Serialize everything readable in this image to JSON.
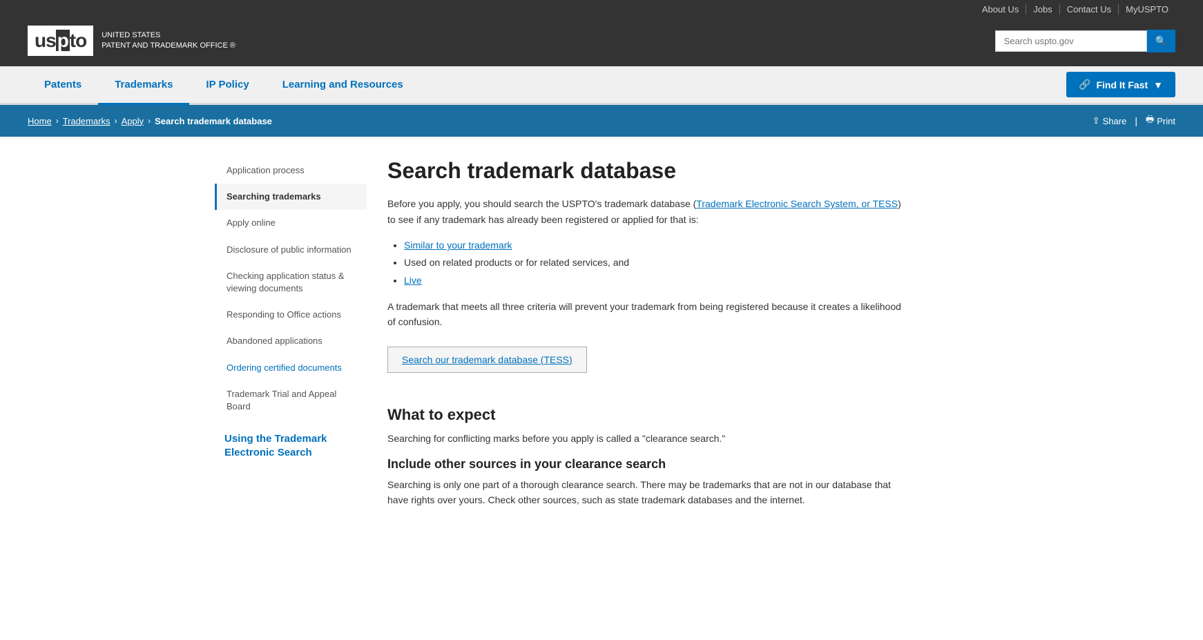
{
  "topbar": {
    "links": [
      "About Us",
      "Jobs",
      "Contact Us",
      "MyUSPTO"
    ]
  },
  "header": {
    "logo_main": "uspto",
    "logo_highlight": "to",
    "logo_tagline_line1": "UNITED STATES",
    "logo_tagline_line2": "PATENT AND TRADEMARK OFFICE",
    "logo_tagline_symbol": "®",
    "search_placeholder": "Search uspto.gov"
  },
  "mainnav": {
    "items": [
      {
        "label": "Patents",
        "active": false
      },
      {
        "label": "Trademarks",
        "active": true
      },
      {
        "label": "IP Policy",
        "active": false
      },
      {
        "label": "Learning and Resources",
        "active": false
      }
    ],
    "find_it_fast": "Find It Fast"
  },
  "breadcrumb": {
    "items": [
      "Home",
      "Trademarks",
      "Apply"
    ],
    "current": "Search trademark database",
    "share_label": "Share",
    "print_label": "Print"
  },
  "sidebar": {
    "items": [
      {
        "label": "Application process",
        "active": false
      },
      {
        "label": "Searching trademarks",
        "active": true
      },
      {
        "label": "Apply online",
        "active": false
      },
      {
        "label": "Disclosure of public information",
        "active": false
      },
      {
        "label": "Checking application status & viewing documents",
        "active": false
      },
      {
        "label": "Responding to Office actions",
        "active": false
      },
      {
        "label": "Abandoned applications",
        "active": false
      },
      {
        "label": "Ordering certified documents",
        "active": false
      },
      {
        "label": "Trademark Trial and Appeal Board",
        "active": false
      }
    ],
    "section_title": "Using the Trademark Electronic Search"
  },
  "main": {
    "page_title": "Search trademark database",
    "intro_text": "Before you apply, you should search the USPTO's trademark database (",
    "tess_link_text": "Trademark Electronic Search System, or TESS",
    "intro_text2": ") to see if any trademark has already been registered or applied for that is:",
    "bullet_items": [
      {
        "text": "Similar to your trademark",
        "is_link": true
      },
      {
        "text": "Used on related products or for related services, and",
        "is_link": false
      },
      {
        "text": "Live",
        "is_link": true
      }
    ],
    "confusion_text": "A trademark that meets all three criteria will prevent your trademark from being registered because it creates a likelihood of confusion.",
    "tess_button_label": "Search our trademark database (TESS)",
    "what_to_expect_heading": "What to expect",
    "what_to_expect_text": "Searching for conflicting marks before you apply is called a \"clearance search.\"",
    "include_sources_heading": "Include other sources in your clearance search",
    "include_sources_text": "Searching is only one part of a thorough clearance search. There may be trademarks that are not in our database that have rights over yours. Check other sources, such as state trademark databases and the internet."
  }
}
